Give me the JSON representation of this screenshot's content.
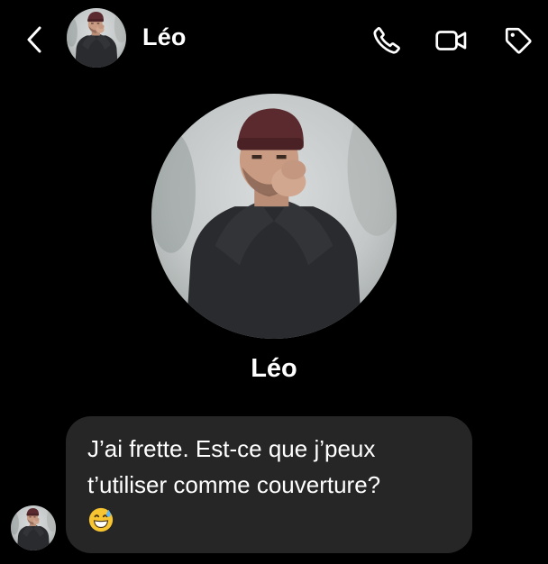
{
  "header": {
    "contact_name": "Léo",
    "back_icon": "chevron-left-icon",
    "actions": [
      "phone-icon",
      "video-camera-icon",
      "tag-icon"
    ]
  },
  "profile": {
    "name": "Léo"
  },
  "messages": [
    {
      "from": "Léo",
      "text": "J’ai frette. Est-ce que j’peux\nt’utiliser comme couverture?",
      "emoji": "grinning-face-with-sweat"
    }
  ],
  "colors": {
    "background": "#000000",
    "bubble": "#262626",
    "text": "#ffffff"
  }
}
